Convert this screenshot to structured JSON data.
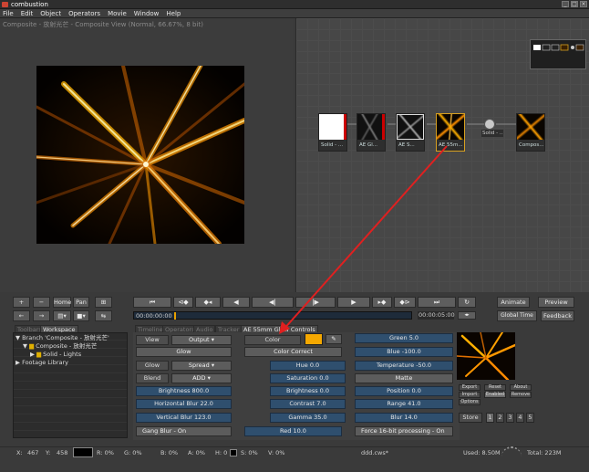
{
  "app": {
    "title": "combustion"
  },
  "menu": [
    "File",
    "Edit",
    "Object",
    "Operators",
    "Movie",
    "Window",
    "Help"
  ],
  "viewer": {
    "title": "Composite - 放射光芒 - Composite View (Normal, 66.67%, 8 bit)"
  },
  "schematic": {
    "nodes": [
      {
        "label": "Solid - ...",
        "kind": "solid"
      },
      {
        "label": "AE Gl...",
        "kind": "dark"
      },
      {
        "label": "AE S...",
        "kind": "dark"
      },
      {
        "label": "AE 55m...",
        "kind": "glow",
        "selected": true
      },
      {
        "label": "Solid - ...",
        "kind": "small"
      },
      {
        "label": "Compos...",
        "kind": "dark"
      }
    ]
  },
  "toolbar_left": {
    "plus": "+",
    "minus": "−",
    "home": "Home",
    "pan": "Pan"
  },
  "transport": {
    "current_time": "00:00:00:00",
    "end_time": "00:00:05:00"
  },
  "right_buttons": {
    "animate": "Animate",
    "preview": "Preview",
    "global_time": "Global Time",
    "feedback": "Feedback"
  },
  "tabs_left": [
    "Toolbars",
    "Workspace"
  ],
  "tabs_right": [
    "Timeline",
    "Operators",
    "Audio",
    "Tracker",
    "AE 55mm Glow Controls"
  ],
  "tree": {
    "items": [
      "Branch 'Composite - 放射光芒'",
      "Composite - 放射光芒",
      "Solid - Lights",
      "Footage Library"
    ]
  },
  "controls": {
    "col1": {
      "view_label": "View",
      "view_value": "Output",
      "glow_header": "Glow",
      "glow_label": "Glow",
      "glow_value": "Spread",
      "blend_label": "Blend",
      "blend_value": "ADD",
      "brightness": "Brightness 800.0",
      "hblur": "Horizontal Blur 22.0",
      "vblur": "Vertical Blur 123.0",
      "gang": "Gang Blur - On"
    },
    "col2": {
      "color_label": "Color",
      "color_swatch": "#f5a800",
      "color_correct": "Color Correct",
      "hue": "Hue 0.0",
      "saturation": "Saturation 0.0",
      "brightness": "Brightness 0.0",
      "contrast": "Contrast 7.0",
      "gamma": "Gamma 35.0",
      "red": "Red 10.0"
    },
    "col3": {
      "green": "Green 5.0",
      "blue": "Blue -100.0",
      "temperature": "Temperature -50.0",
      "matte": "Matte",
      "position": "Position 0.0",
      "range": "Range 41.0",
      "blur": "Blur 14.0",
      "force16": "Force 16-bit processing - On"
    }
  },
  "side_buttons": {
    "export": "Export",
    "reset": "Reset",
    "about": "About",
    "import": "Import",
    "enabled": "Enabled",
    "remove": "Remove",
    "options": "Options",
    "store": "Store",
    "slots": [
      "1",
      "2",
      "3",
      "4",
      "5"
    ]
  },
  "status": {
    "x": "X:",
    "x_val": "467",
    "y": "Y:",
    "y_val": "458",
    "r": "R: 0%",
    "g": "G: 0%",
    "b": "B: 0%",
    "a": "A: 0%",
    "h": "H: 0",
    "s": "S: 0%",
    "v": "V: 0%",
    "file": "ddd.cws*",
    "used": "Used: 8.50M",
    "total": "Total: 223M"
  },
  "colors": {
    "accent": "#e8a000",
    "arrow": "#e02020",
    "slider": "#2f4f6e"
  }
}
